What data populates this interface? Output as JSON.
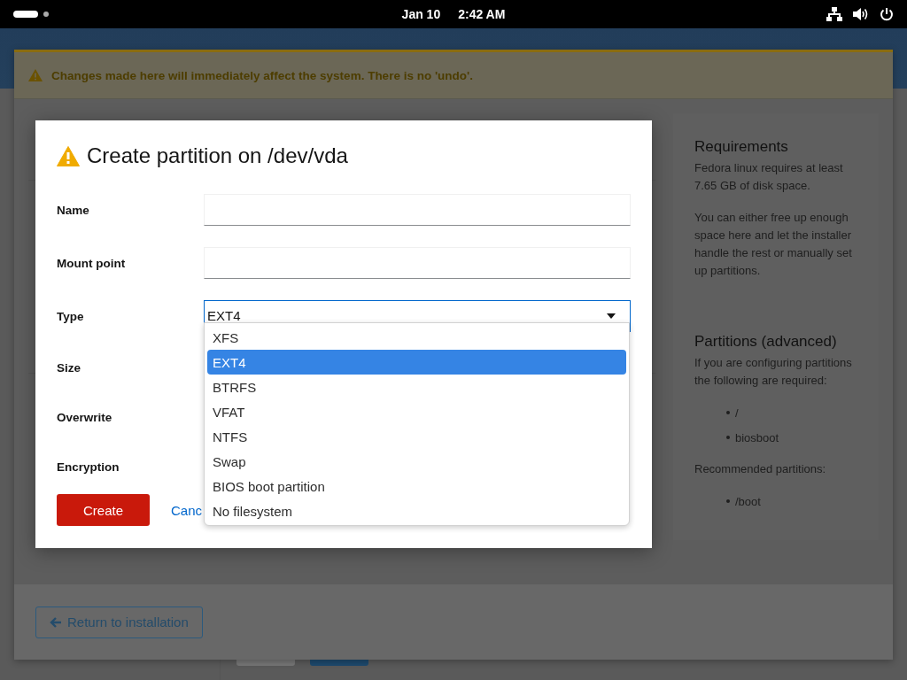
{
  "top_bar": {
    "date": "Jan 10",
    "time": "2:42 AM"
  },
  "warning_banner": {
    "text": "Changes made here will immediately affect the system. There is no 'undo'."
  },
  "dialog": {
    "title": "Create partition on /dev/vda",
    "fields": [
      {
        "label": "Name",
        "kind": "text"
      },
      {
        "label": "Mount point",
        "kind": "text"
      },
      {
        "label": "Type",
        "kind": "select",
        "value": "EXT4",
        "expanded": true
      },
      {
        "label": "Size",
        "kind": "covered"
      },
      {
        "label": "Overwrite",
        "kind": "covered"
      },
      {
        "label": "Encryption",
        "kind": "covered"
      }
    ],
    "type_options": [
      {
        "label": "XFS",
        "selected": false
      },
      {
        "label": "EXT4",
        "selected": true
      },
      {
        "label": "BTRFS",
        "selected": false
      },
      {
        "label": "VFAT",
        "selected": false
      },
      {
        "label": "NTFS",
        "selected": false
      },
      {
        "label": "Swap",
        "selected": false
      },
      {
        "label": "BIOS boot partition",
        "selected": false
      },
      {
        "label": "No filesystem",
        "selected": false
      }
    ],
    "create_button": "Create",
    "cancel_link": "Canc"
  },
  "sidebar": {
    "sections": [
      {
        "heading": "Requirements",
        "blocks": [
          {
            "kind": "text",
            "text": "Fedora linux requires at least 7.65 GB of disk space."
          },
          {
            "kind": "text",
            "text": "You can either free up enough space here and let the installer handle the rest or manually set up partitions."
          }
        ]
      },
      {
        "heading": "Partitions (advanced)",
        "blocks": [
          {
            "kind": "text",
            "text": "If you are configuring partitions the following are required:"
          },
          {
            "kind": "list",
            "items": [
              "/",
              "biosboot"
            ]
          },
          {
            "kind": "text",
            "text": "Recommended partitions:"
          },
          {
            "kind": "list",
            "items": [
              "/boot"
            ]
          }
        ]
      }
    ]
  },
  "footer": {
    "return_button": "Return to installation"
  }
}
